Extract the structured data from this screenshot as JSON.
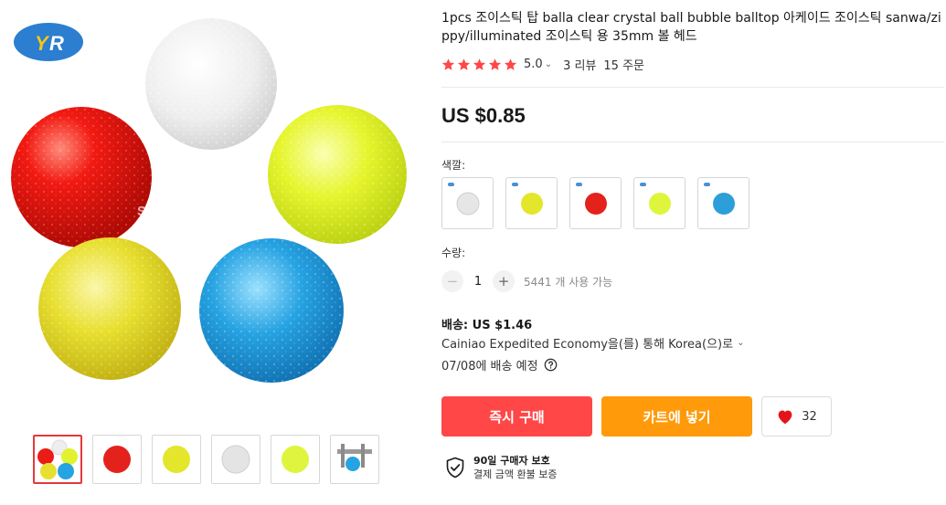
{
  "product": {
    "title": "1pcs 조이스틱 탑 balla clear crystal ball bubble balltop 아케이드 조이스틱 sanwa/zippy/illuminated 조이스틱 용 35mm 볼 헤드",
    "rating": "5.0",
    "reviews": "3 리뷰",
    "orders": "15 주문",
    "price": "US $0.85",
    "watermark": "Store No: 1313333"
  },
  "color": {
    "label": "색깔:",
    "options": [
      {
        "name": "clear",
        "color": "#e6e6e6"
      },
      {
        "name": "yellow",
        "color": "#e3e62a"
      },
      {
        "name": "red",
        "color": "#e3221c"
      },
      {
        "name": "lime",
        "color": "#dff53d"
      },
      {
        "name": "blue",
        "color": "#2c9fd8"
      }
    ]
  },
  "quantity": {
    "label": "수량:",
    "minus": "−",
    "value": "1",
    "plus": "+",
    "available": "5441 개 사용 가능"
  },
  "shipping": {
    "cost": "배송: US $1.46",
    "method": "Cainiao Expedited Economy을(를) 통해 Korea(으)로",
    "delivery": "07/08에 배송 예정"
  },
  "actions": {
    "buy_now": "즉시 구매",
    "add_to_cart": "카트에 넣기",
    "wishlist_count": "32"
  },
  "protection": {
    "title": "90일 구매자 보호",
    "subtitle": "결제 금액 환불 보증"
  },
  "icons": {
    "chevron": "chevron-down-icon",
    "help": "help-icon",
    "heart": "heart-icon",
    "shield": "shield-check-icon",
    "star": "star-icon"
  },
  "colors": {
    "buy": "#ff4747",
    "cart": "#ff9a0a",
    "star": "#ff4747"
  }
}
